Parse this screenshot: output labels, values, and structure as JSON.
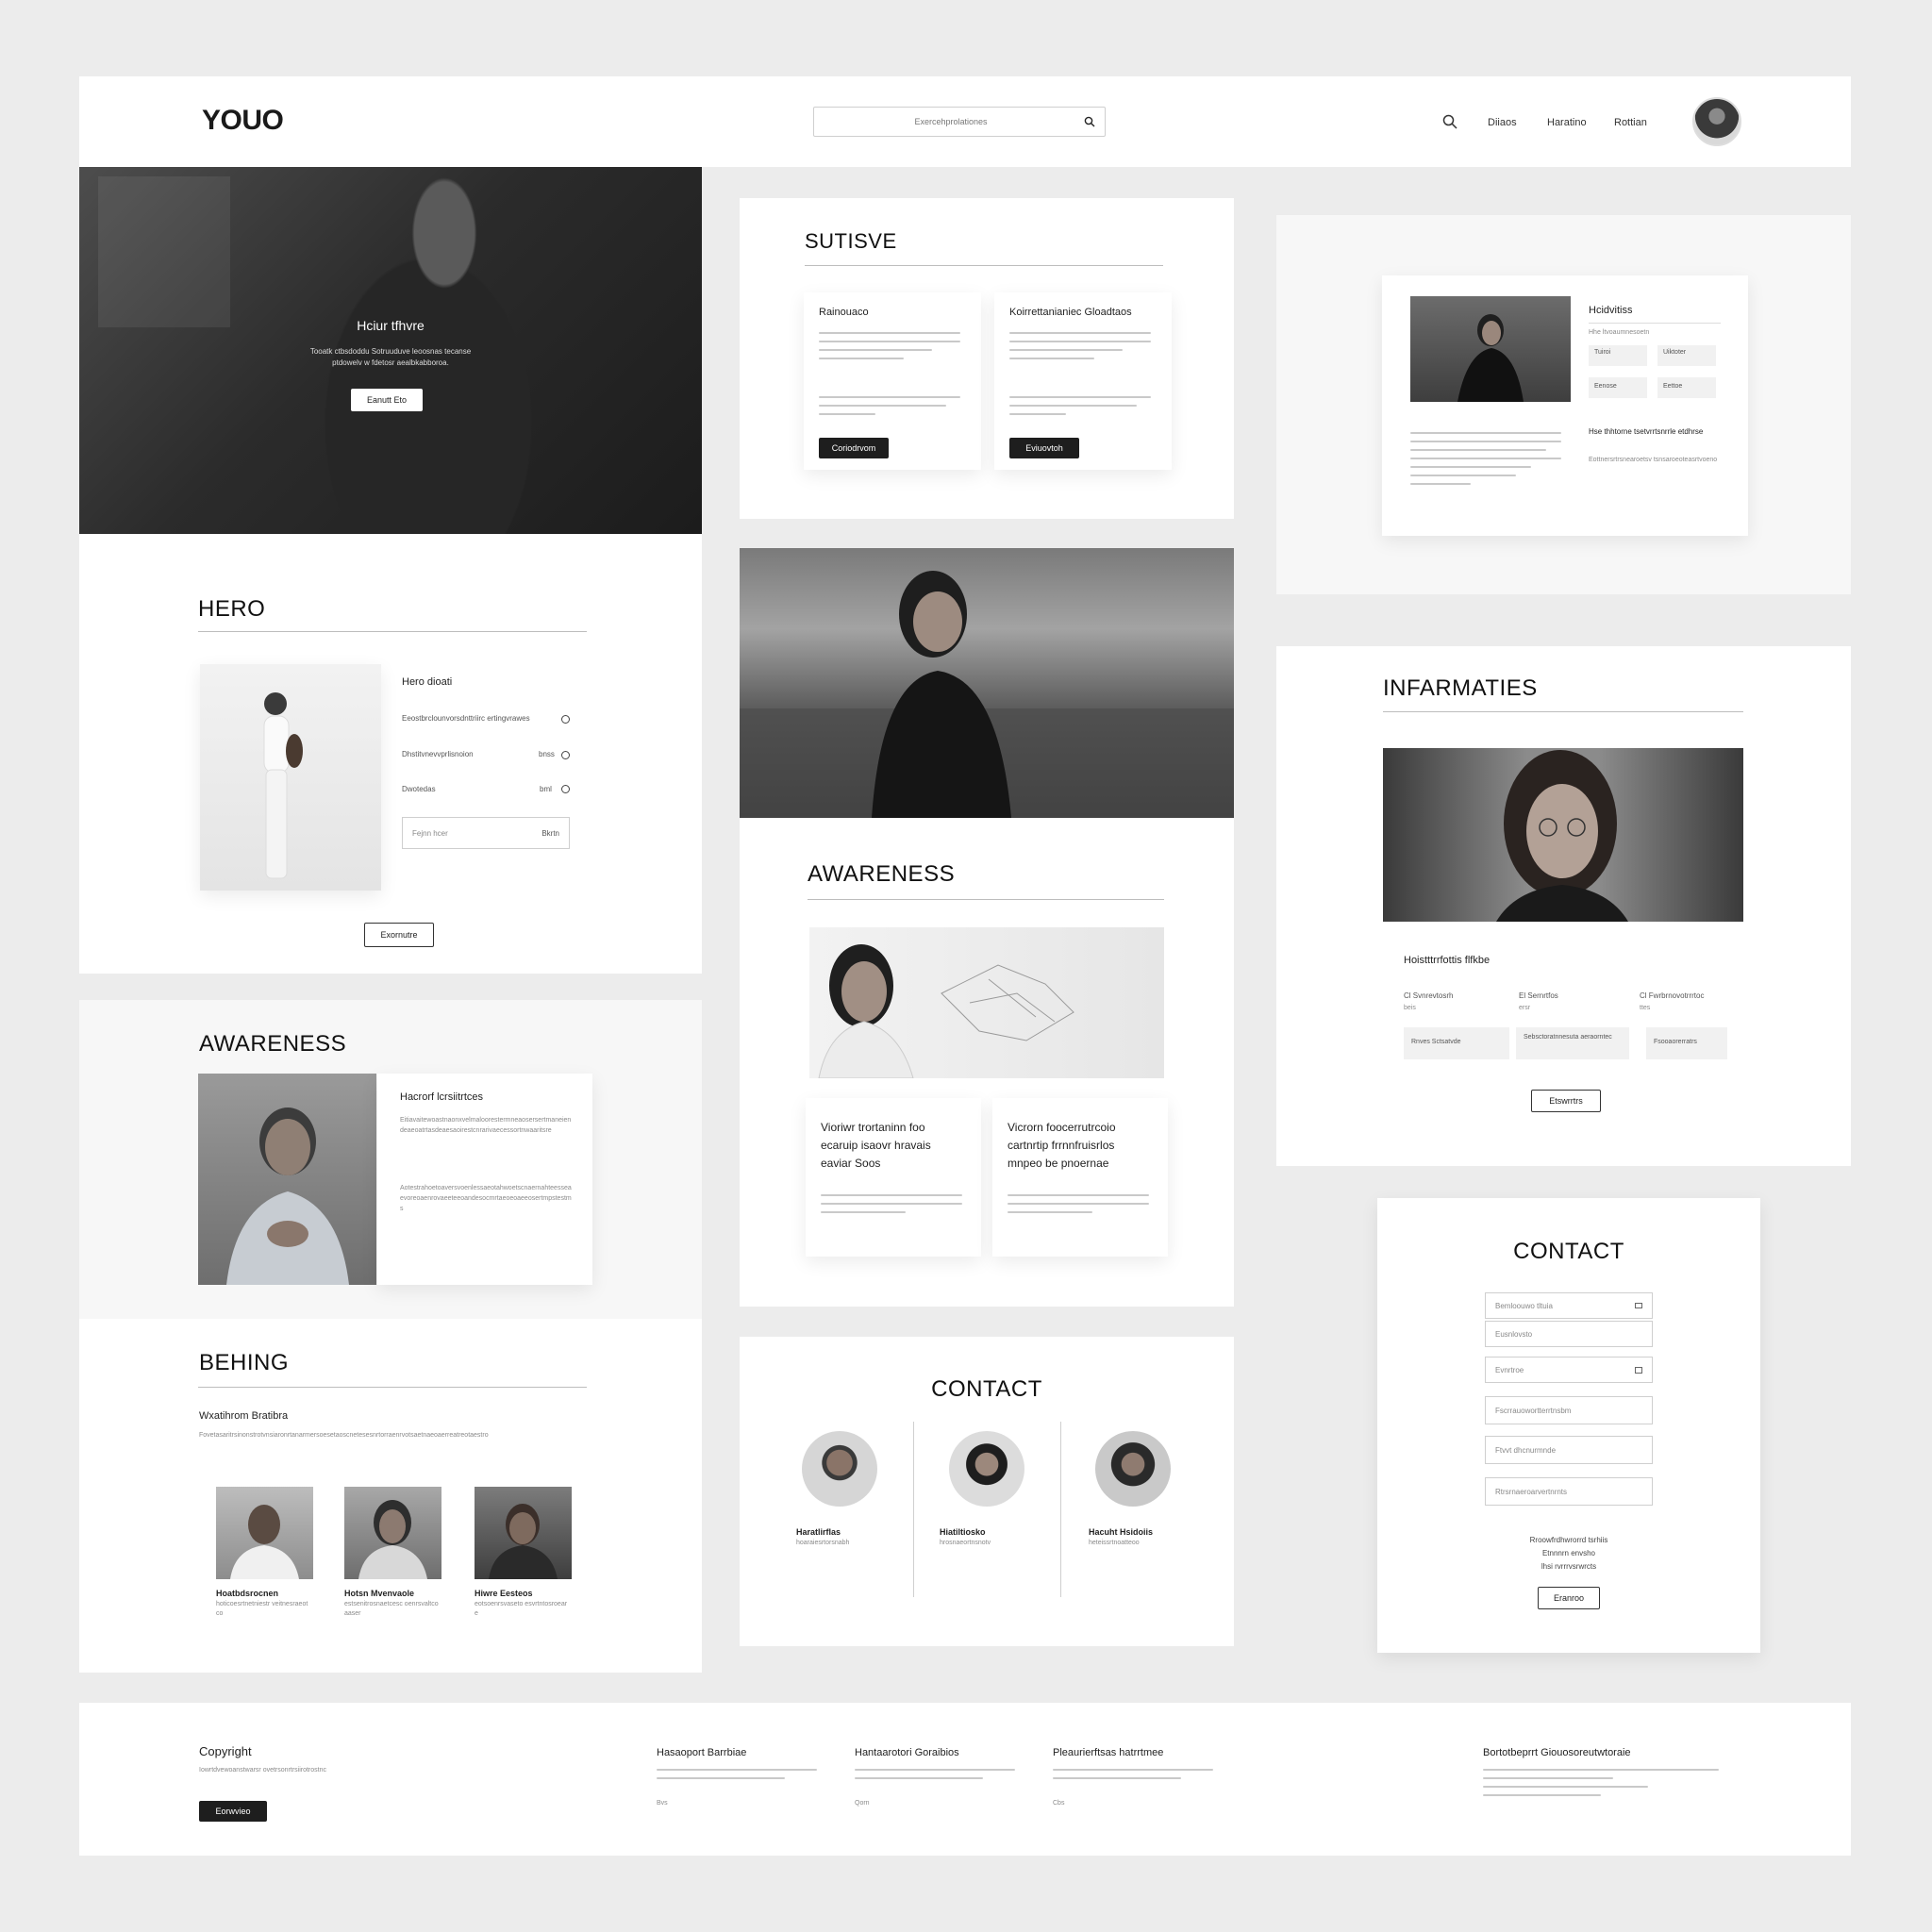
{
  "header": {
    "logo": "YOUO",
    "search_placeholder": "Exercehprolationes",
    "nav": [
      "Diiaos",
      "Haratino",
      "Rottian"
    ]
  },
  "hero_banner": {
    "title": "Hciur tfhvre",
    "text": "Tooatk ctbsdoddu Sotruuduve leoosnas tecanse ptdowelv w fdetosr aealbkabboroa.",
    "button": "Eanutt Eto"
  },
  "hero": {
    "heading": "HERO",
    "subtitle": "Hero dioati",
    "options": [
      {
        "label": "Eeostbrclounvorsdnttriirc ertingvrawes",
        "tag": ""
      },
      {
        "label": "Dhstitvnevvprlisnoion",
        "tag": "bnss"
      },
      {
        "label": "Dwotedas",
        "tag": "bml"
      }
    ],
    "input_placeholder": "Fejnn hcer",
    "input_action": "Bkrtn",
    "button": "Exornutre"
  },
  "awareness_left": {
    "heading": "AWARENESS",
    "card_title": "Hacrorf lcrsiitrtces",
    "text1": "Eitiavaitewoastnaonxvelmaloorestermneaosersertmaneiendeaeoatrtasdeaesaoirestcnrarivaecessortnwaaritsre",
    "text2": "Aotestrahoetoaversvoenlessaeotahwoetscnaernahteesseaevoreoaenrovaeeteeoandesocmrtaeoeoaeeosertmpstestms"
  },
  "behing": {
    "heading": "BEHING",
    "subtitle": "Wxatihrom Bratibra",
    "text": "Fovetasaritrsinonstrotvnsiaronrtanarmersoesetaoscnetesesnrtorraenrvotsaetnaeoaerreatreotaestro",
    "people": [
      {
        "name": "Hoatbdsrocnen",
        "text": "hoticoesrtnetniestr veitnesraeotco"
      },
      {
        "name": "Hotsn Mvenvaole",
        "text": "estsenitrosnaetcesc oenrsvaltcoaaser"
      },
      {
        "name": "Hiwre Eesteos",
        "text": "eotsoenrsvaseto esvrtntosroeare"
      }
    ]
  },
  "sutisve": {
    "heading": "SUTISVE",
    "cards": [
      {
        "title": "Rainouaco",
        "button": "Coriodrvom"
      },
      {
        "title": "Koirrettanianiec Gloadtaos",
        "button": "Eviuovtoh"
      }
    ]
  },
  "awareness_center": {
    "heading": "AWARENESS",
    "cards": [
      {
        "title": "Vioriwr trortaninn foo ecaruip isaovr hravais eaviar Soos"
      },
      {
        "title": "Vicrorn foocerrutrcoio cartnrtip frrnnfruisrlos mnpeo be pnoernae"
      }
    ]
  },
  "contact_center": {
    "heading": "CONTACT",
    "people": [
      {
        "name": "Haratlirflas",
        "text": "hoaraiesrtorsnabh"
      },
      {
        "name": "Hiatiltiosko",
        "text": "hrosnaeortnsnotv"
      },
      {
        "name": "Hacuht Hsidoiis",
        "text": "heteissrtnoatteoo"
      }
    ]
  },
  "profile_card": {
    "title": "Hcidvitiss",
    "subtitle": "Hhe ltvoaumnesoetn",
    "chips": [
      "Tuiroi",
      "Uiktoter",
      "Eenose",
      "Eettoe"
    ],
    "right_title": "Hse thhtorne tsetvrrtsnrrle etdhrse",
    "text": "Eottnersrtrsnearoetsv tsnsaroeoteasrtvoeno"
  },
  "infarmaties": {
    "heading": "INFARMATIES",
    "subtitle": "Hoistttrrfottis flfkbe",
    "columns": [
      {
        "label": "Cl Svnrevtosrh",
        "sub": "beis",
        "field": "Rnves Sctsatvde"
      },
      {
        "label": "El Sernrtfos",
        "sub": "ersr",
        "field": "Sebsctoratnnesuta aeraorntec"
      },
      {
        "label": "Cl Fwrbrnovotrrrtoc",
        "sub": "ttes",
        "field": "Fsooaorerratrs"
      }
    ],
    "button": "Etswrrtrs"
  },
  "contact_right": {
    "heading": "CONTACT",
    "fields": [
      "Bemloouwo tltuia",
      "Eusnlovsto",
      "Evnrtroe",
      "Fscrrauowortterrtnsbm",
      "Ftvvt dhcnurmnde",
      "Rtrsrnaeroarvertnrnts"
    ],
    "footer_lines": [
      "Rroowfrdhwrorrd tsrhiis",
      "Etnnnrn envsho",
      "lhsi rvrrrvsrwrcts"
    ],
    "button": "Eranroo"
  },
  "footer": {
    "copyright_title": "Copyright",
    "copyright_text": "Iowrtdvewoanstwarsr ovetrsonrtrsiirotrostnc",
    "button": "Eorwvieo",
    "col_titles": [
      "Hasaoport Barrbiae",
      "Hantaarotori Goraibios",
      "Pleaurierftsas hatrrtmee"
    ],
    "right_title": "Bortotbeprrt Giouosoreutwtoraie",
    "col_small": [
      "Bvs",
      "Qorn",
      "Cbs"
    ]
  }
}
